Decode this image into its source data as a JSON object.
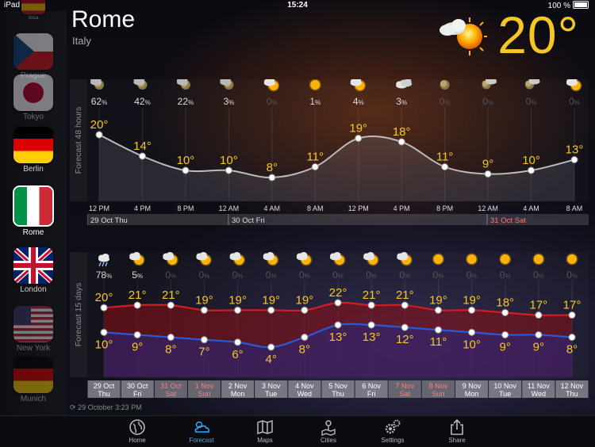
{
  "status_bar": {
    "carrier": "iPad",
    "time": "15:24",
    "battery": "100 %"
  },
  "sidebar": {
    "cities": [
      {
        "label": "Ibiza",
        "flag": "spain",
        "dim": true
      },
      {
        "label": "Prague",
        "flag": "czech",
        "dim": true
      },
      {
        "label": "Tokyo",
        "flag": "japan",
        "dim": true
      },
      {
        "label": "Berlin",
        "flag": "germany",
        "dim": false
      },
      {
        "label": "Rome",
        "flag": "italy",
        "dim": false,
        "active": true
      },
      {
        "label": "London",
        "flag": "uk",
        "dim": false
      },
      {
        "label": "New York",
        "flag": "usa",
        "dim": true
      },
      {
        "label": "Munich",
        "flag": "germany",
        "dim": true
      }
    ]
  },
  "header": {
    "city": "Rome",
    "country": "Italy",
    "current_temp": "20°",
    "current_icon": "sun-cloud-icon"
  },
  "forecast_48": {
    "label": "Forecast 48 hours",
    "hours": [
      "12 PM",
      "4 PM",
      "8 PM",
      "12 AM",
      "4 AM",
      "8 AM",
      "12 PM",
      "4 PM",
      "8 PM",
      "12 AM",
      "4 AM",
      "8 AM"
    ],
    "temps": [
      20,
      14,
      10,
      10,
      8,
      11,
      19,
      18,
      11,
      9,
      10,
      13
    ],
    "temp_labels": [
      "20°",
      "14°",
      "10°",
      "10°",
      "8°",
      "11°",
      "19°",
      "18°",
      "11°",
      "9°",
      "10°",
      "13°"
    ],
    "precip": [
      "62",
      "42",
      "22",
      "3",
      "0",
      "1",
      "4",
      "3",
      "0",
      "0",
      "0",
      "0"
    ],
    "icons": [
      "moon-rain-icon",
      "moon-rain-icon",
      "moon-rain-icon",
      "moon-rain-icon",
      "sun-cloud-icon",
      "sun-icon",
      "sun-cloud-icon",
      "cloud-icon",
      "moon-icon",
      "moon-cloud-icon",
      "moon-cloud-icon",
      "sun-cloud-icon"
    ],
    "days": [
      {
        "label": "29 Oct Thu",
        "weekend": false
      },
      {
        "label": "30 Oct Fri",
        "weekend": false
      },
      {
        "label": "31 Oct Sat",
        "weekend": true
      }
    ]
  },
  "forecast_15": {
    "label": "Forecast 15 days",
    "dates": [
      "29 Oct",
      "30 Oct",
      "31 Oct",
      "1 Nov",
      "2 Nov",
      "3 Nov",
      "4 Nov",
      "5 Nov",
      "6 Nov",
      "7 Nov",
      "8 Nov",
      "9 Nov",
      "10 Nov",
      "11 Nov",
      "12 Nov"
    ],
    "weekdays": [
      "Thu",
      "Fri",
      "Sat",
      "Sun",
      "Mon",
      "Tue",
      "Wed",
      "Thu",
      "Fri",
      "Sat",
      "Sun",
      "Mon",
      "Tue",
      "Wed",
      "Thu"
    ],
    "weekend": [
      false,
      false,
      true,
      true,
      false,
      false,
      false,
      false,
      false,
      true,
      true,
      false,
      false,
      false,
      false
    ],
    "highs": [
      20,
      21,
      21,
      19,
      19,
      19,
      19,
      22,
      21,
      21,
      19,
      19,
      18,
      17,
      17
    ],
    "lows": [
      10,
      9,
      8,
      7,
      6,
      4,
      8,
      13,
      13,
      12,
      11,
      10,
      9,
      9,
      8
    ],
    "high_labels": [
      "20°",
      "21°",
      "21°",
      "19°",
      "19°",
      "19°",
      "19°",
      "22°",
      "21°",
      "21°",
      "19°",
      "19°",
      "18°",
      "17°",
      "17°"
    ],
    "low_labels": [
      "10°",
      "9°",
      "8°",
      "7°",
      "6°",
      "4°",
      "8°",
      "13°",
      "13°",
      "12°",
      "11°",
      "10°",
      "9°",
      "9°",
      "8°"
    ],
    "precip": [
      "78",
      "5",
      "0",
      "0",
      "0",
      "0",
      "0",
      "0",
      "0",
      "0",
      "0",
      "0",
      "0",
      "0",
      "0"
    ],
    "icons": [
      "rain-cloud-icon",
      "sun-cloud-icon",
      "sun-cloud-icon",
      "sun-cloud-icon",
      "sun-cloud-icon",
      "sun-cloud-icon",
      "sun-cloud-icon",
      "sun-cloud-icon",
      "sun-cloud-icon",
      "sun-cloud-icon",
      "sun-icon",
      "sun-icon",
      "sun-icon",
      "sun-icon",
      "sun-icon"
    ]
  },
  "pct_symbol": "%",
  "last_update": "29 October 3:23 PM",
  "tabs": [
    {
      "label": "Home",
      "icon": "globe-icon"
    },
    {
      "label": "Forecast",
      "icon": "forecast-icon",
      "active": true
    },
    {
      "label": "Maps",
      "icon": "map-icon"
    },
    {
      "label": "Cities",
      "icon": "cities-icon"
    },
    {
      "label": "Settings",
      "icon": "gears-icon"
    },
    {
      "label": "Share",
      "icon": "share-icon"
    }
  ],
  "colors": {
    "accent": "#f6c624",
    "high_line": "#d31d24",
    "low_line": "#2a5ad8",
    "tab_active": "#35a8ff",
    "weekend": "#ff7a7a"
  }
}
